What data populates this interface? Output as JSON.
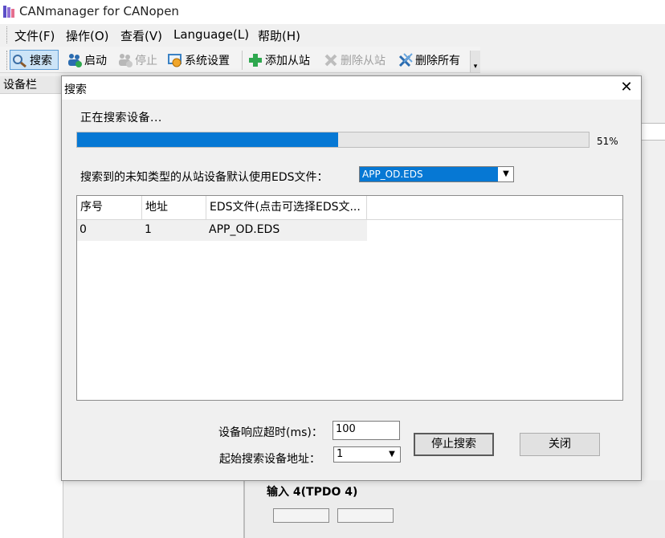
{
  "app": {
    "title": "CANmanager for CANopen",
    "menu": [
      "文件(F)",
      "操作(O)",
      "查看(V)",
      "Language(L)",
      "帮助(H)"
    ],
    "toolbar": {
      "search": "搜索",
      "start": "启动",
      "stop": "停止",
      "settings": "系统设置",
      "add_slave": "添加从站",
      "delete_slave": "删除从站",
      "delete_all": "删除所有"
    },
    "left_panel_title": "设备栏",
    "background": {
      "section_label": "输入 4(TPDO 4)"
    }
  },
  "dialog": {
    "title": "搜索",
    "status": "正在搜索设备...",
    "progress": {
      "percent": 51,
      "label": "51%"
    },
    "eds_label": "搜索到的未知类型的从站设备默认使用EDS文件：",
    "eds_selected": "APP_OD.EDS",
    "table": {
      "columns": [
        "序号",
        "地址",
        "EDS文件(点击可选择EDS文..."
      ],
      "rows": [
        [
          "0",
          "1",
          "APP_OD.EDS"
        ]
      ]
    },
    "timeout_label": "设备响应超时(ms)：",
    "timeout_value": "100",
    "start_addr_label": "起始搜索设备地址：",
    "start_addr_value": "1",
    "stop_search_button": "停止搜索",
    "close_button": "关闭"
  },
  "colors": {
    "accent": "#0678d4",
    "pressed_bg": "#cce4f7"
  },
  "icons": [
    "app-logo-icon",
    "search-icon",
    "start-icon",
    "stop-icon",
    "settings-icon",
    "add-icon",
    "delete-icon",
    "delete-all-icon",
    "close-icon",
    "dropdown-arrow-icon"
  ]
}
